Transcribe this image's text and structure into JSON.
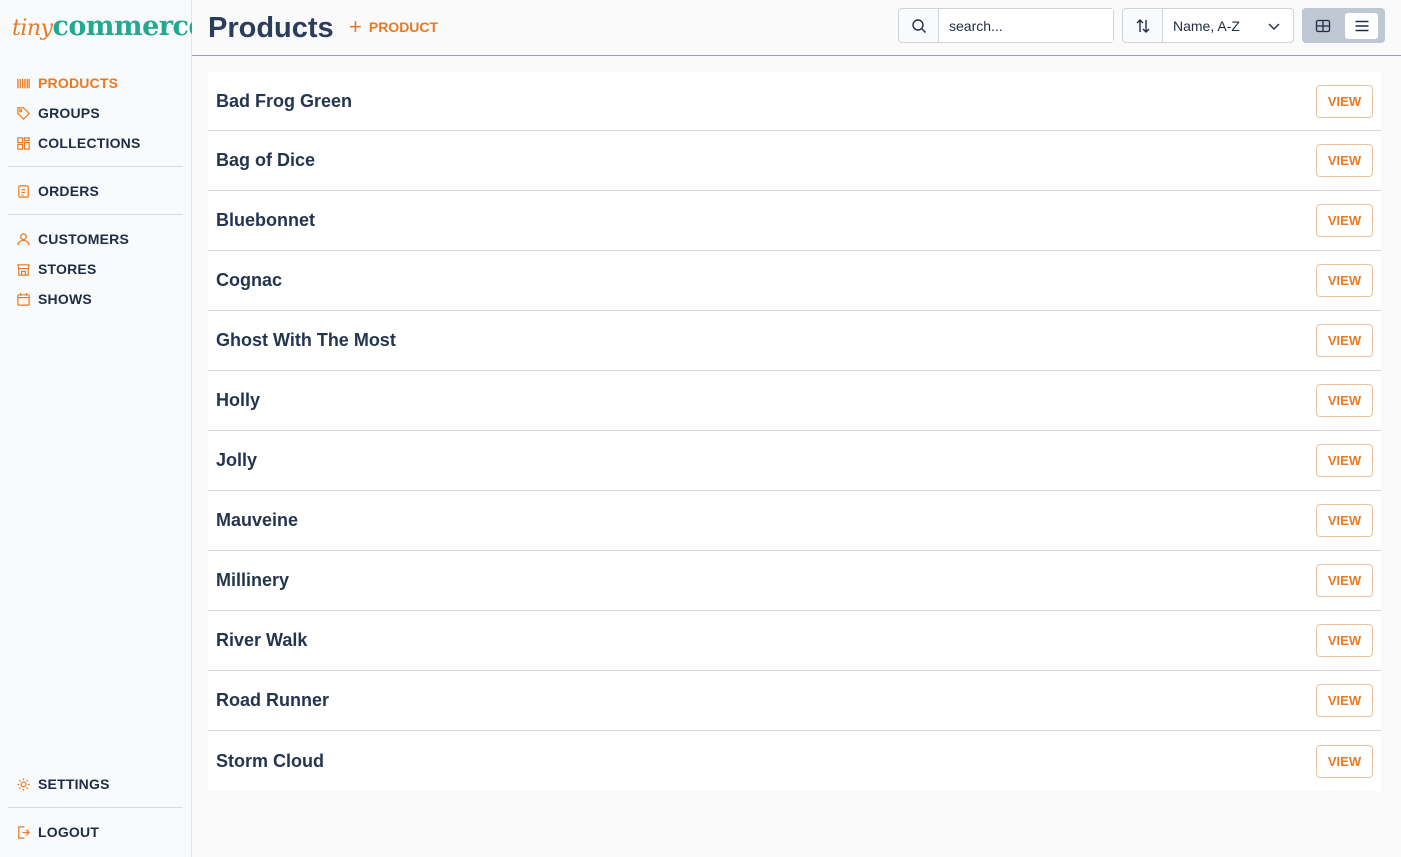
{
  "brand": {
    "part1": "tiny",
    "part2": "commerce"
  },
  "colors": {
    "accent": "#e97a22",
    "brand_teal": "#23a891",
    "text": "#1e2d45"
  },
  "sidebar": {
    "items": [
      {
        "label": "PRODUCTS",
        "icon": "barcode-icon",
        "active": true
      },
      {
        "label": "GROUPS",
        "icon": "tag-icon",
        "active": false
      },
      {
        "label": "COLLECTIONS",
        "icon": "grid-icon",
        "active": false
      },
      {
        "label": "ORDERS",
        "icon": "clipboard-icon",
        "active": false
      },
      {
        "label": "CUSTOMERS",
        "icon": "user-icon",
        "active": false
      },
      {
        "label": "STORES",
        "icon": "store-icon",
        "active": false
      },
      {
        "label": "SHOWS",
        "icon": "calendar-icon",
        "active": false
      }
    ],
    "settings_label": "SETTINGS",
    "logout_label": "LOGOUT"
  },
  "header": {
    "title": "Products",
    "add_label": "PRODUCT",
    "search": {
      "placeholder": "search...",
      "value": ""
    },
    "sort": {
      "selected": "Name, A-Z"
    },
    "view_mode": "list"
  },
  "products": {
    "view_label": "VIEW",
    "items": [
      "Bad Frog Green",
      "Bag of Dice",
      "Bluebonnet",
      "Cognac",
      "Ghost With The Most",
      "Holly",
      "Jolly",
      "Mauveine",
      "Millinery",
      "River Walk",
      "Road Runner",
      "Storm Cloud"
    ]
  }
}
